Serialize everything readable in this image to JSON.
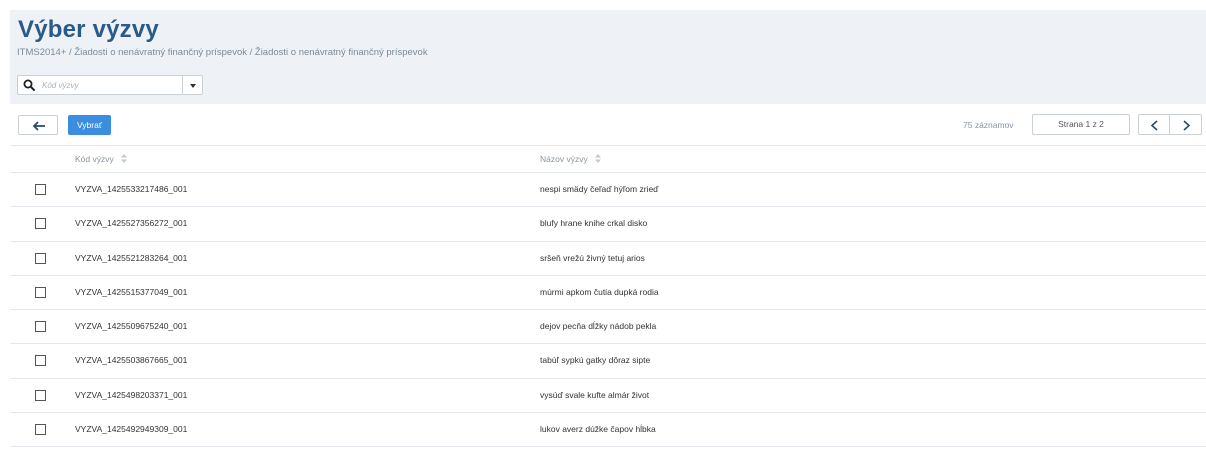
{
  "header": {
    "title": "Výber výzvy",
    "breadcrumb": "ITMS2014+ / Žiadosti o nenávratný finančný príspevok / Žiadosti o nenávratný finančný príspevok"
  },
  "search": {
    "placeholder": "Kód výzvy",
    "icon": "search-icon"
  },
  "toolbar": {
    "back_icon": "arrow-left-icon",
    "select_label": "Vybrať"
  },
  "pagination": {
    "records": "75 záznamov",
    "page": "Strana 1 z 2"
  },
  "table": {
    "columns": [
      "Kód výzvy",
      "Názov výzvy"
    ],
    "rows": [
      {
        "code": "VYZVA_1425533217486_001",
        "name": "nespi smädy čeľaď hýľom zrieď"
      },
      {
        "code": "VYZVA_1425527356272_001",
        "name": "blufy hrane knihe crkal disko"
      },
      {
        "code": "VYZVA_1425521283264_001",
        "name": "sršeň vrežú živný tetuj arios"
      },
      {
        "code": "VYZVA_1425515377049_001",
        "name": "múrmi apkom čutia dupká rodia"
      },
      {
        "code": "VYZVA_1425509675240_001",
        "name": "dejov pecňa dĺžky nádob pekla"
      },
      {
        "code": "VYZVA_1425503867665_001",
        "name": "tabúľ sypkú gatky dôraz sipte"
      },
      {
        "code": "VYZVA_1425498203371_001",
        "name": "vysúď svale kufte almár život"
      },
      {
        "code": "VYZVA_1425492949309_001",
        "name": "lukov averz dúžke čapov hĺbka"
      }
    ]
  },
  "colors": {
    "title": "#2a5a8a",
    "header_bg": "#eef2f6",
    "primary_button": "#3b8de0"
  }
}
